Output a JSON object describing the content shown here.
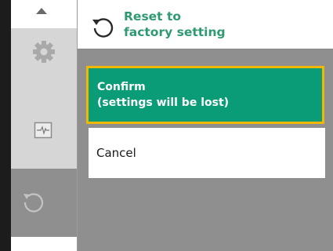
{
  "sidebar": {
    "items": [
      {
        "icon": "gear-icon"
      },
      {
        "icon": "trend-monitor-icon"
      },
      {
        "icon": "reset-icon",
        "active": true
      }
    ]
  },
  "header": {
    "title": "Reset to\nfactory setting",
    "icon": "reset-icon",
    "color": "#2f9a72"
  },
  "menu": {
    "confirm_label": "Confirm\n(settings will be lost)",
    "cancel_label": "Cancel"
  },
  "colors": {
    "accent": "#0a9b77",
    "focus_border": "#f2b705",
    "background": "#8f8f8f"
  }
}
